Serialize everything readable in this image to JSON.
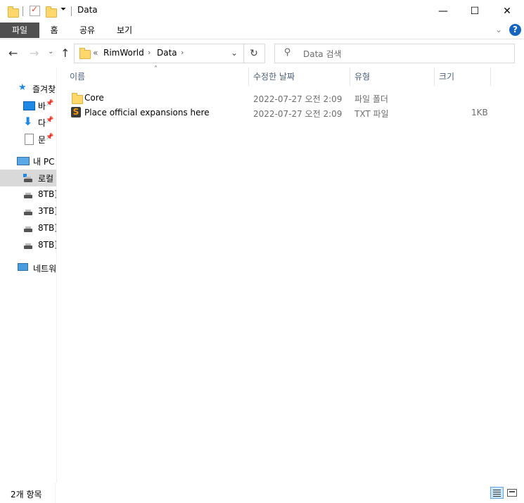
{
  "window": {
    "title": "Data",
    "minimize_glyph": "—",
    "maximize_glyph": "☐",
    "close_glyph": "✕"
  },
  "ribbon": {
    "tabs": [
      {
        "label": "파일"
      },
      {
        "label": "홈"
      },
      {
        "label": "공유"
      },
      {
        "label": "보기"
      }
    ],
    "help_glyph": "?"
  },
  "address": {
    "overflow": "«",
    "crumbs": [
      "RimWorld",
      "Data"
    ]
  },
  "search": {
    "placeholder": "Data 검색"
  },
  "nav": {
    "quick_access": "즐겨찾",
    "pinned": [
      "바",
      "다",
      "문"
    ],
    "this_pc": "내 PC",
    "drives": [
      "로컬",
      "8TB]",
      "3TB]",
      "8TB]",
      "8TB]"
    ],
    "network": "네트워"
  },
  "columns": {
    "name": "이름",
    "date": "수정한 날짜",
    "type": "유형",
    "size": "크기"
  },
  "files": [
    {
      "name": "Core",
      "date": "2022-07-27 오전 2:09",
      "type": "파일 폴더",
      "size": "",
      "icon": "folder-icon"
    },
    {
      "name": "Place official expansions here",
      "date": "2022-07-27 오전 2:09",
      "type": "TXT 파일",
      "size": "1KB",
      "icon": "sublime-text-file-icon"
    }
  ],
  "status": {
    "count": "2개 항목"
  },
  "colors": {
    "file_tab": "#505050",
    "header_text": "#4c607a",
    "selection": "#d9d9d9",
    "help": "#1565c0"
  }
}
